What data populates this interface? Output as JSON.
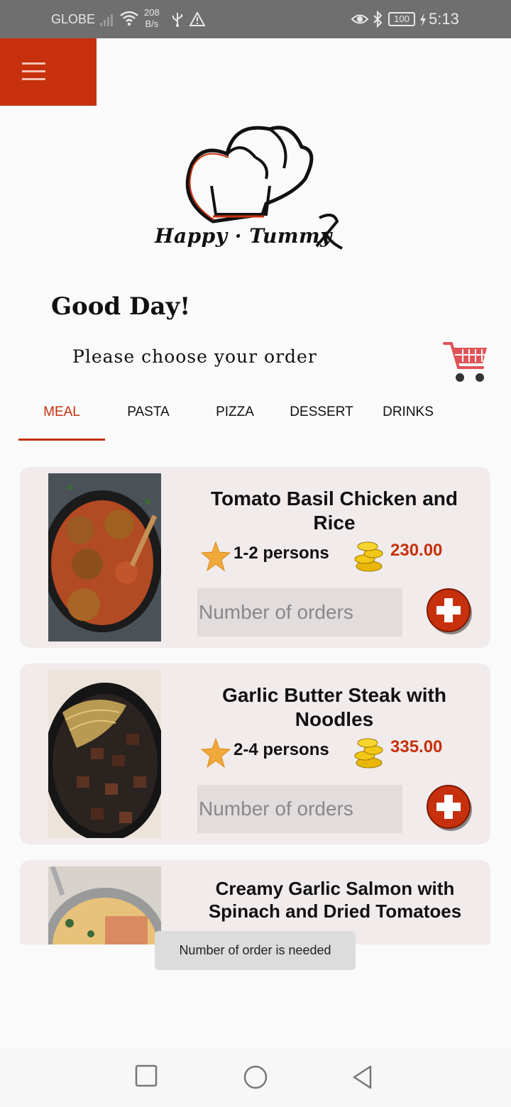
{
  "status_bar": {
    "carrier": "GLOBE",
    "net_speed_value": "208",
    "net_speed_unit": "B/s",
    "battery": "100",
    "time": "5:13"
  },
  "brand": {
    "name": "Happy · Tummy",
    "accent_color": "#c6300c"
  },
  "greeting": "Good Day!",
  "subtitle": "Please choose your order",
  "tabs": [
    {
      "label": "MEAL",
      "active": true
    },
    {
      "label": "PASTA",
      "active": false
    },
    {
      "label": "PIZZA",
      "active": false
    },
    {
      "label": "DESSERT",
      "active": false
    },
    {
      "label": "DRINKS",
      "active": false
    }
  ],
  "menu_items": [
    {
      "title": "Tomato Basil Chicken and Rice",
      "persons": "1-2 persons",
      "price": "230.00",
      "placeholder": "Number of orders"
    },
    {
      "title": "Garlic Butter Steak with Noodles",
      "persons": "2-4 persons",
      "price": "335.00",
      "placeholder": "Number of orders"
    },
    {
      "title": "Creamy Garlic Salmon with Spinach and Dried Tomatoes"
    }
  ],
  "toast": "Number of order is needed"
}
